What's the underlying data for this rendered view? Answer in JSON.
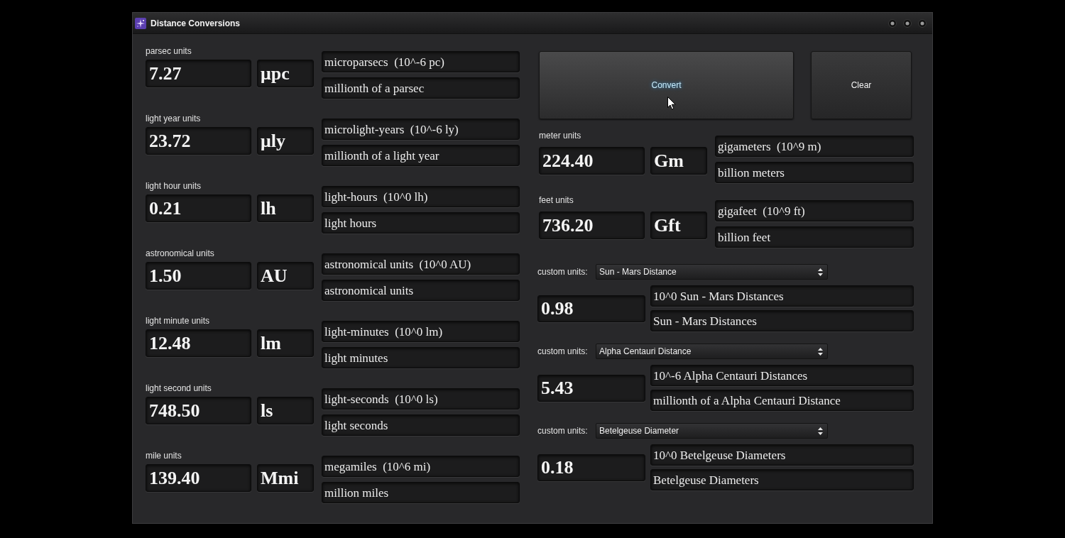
{
  "window": {
    "title": "Distance Conversions"
  },
  "unit_groups": [
    {
      "label": "parsec units",
      "value": "7.27",
      "unit": "μpc",
      "scale": "microparsecs  (10^-6 pc)",
      "description": "millionth of a parsec"
    },
    {
      "label": "light year units",
      "value": "23.72",
      "unit": "μly",
      "scale": "microlight-years  (10^-6 ly)",
      "description": "millionth of a light year"
    },
    {
      "label": "light hour units",
      "value": "0.21",
      "unit": "lh",
      "scale": "light-hours  (10^0 lh)",
      "description": "light hours"
    },
    {
      "label": "astronomical units",
      "value": "1.50",
      "unit": "AU",
      "scale": "astronomical units  (10^0 AU)",
      "description": "astronomical units"
    },
    {
      "label": "light minute units",
      "value": "12.48",
      "unit": "lm",
      "scale": "light-minutes  (10^0 lm)",
      "description": "light minutes"
    },
    {
      "label": "light second units",
      "value": "748.50",
      "unit": "ls",
      "scale": "light-seconds  (10^0 ls)",
      "description": "light seconds"
    },
    {
      "label": "mile units",
      "value": "139.40",
      "unit": "Mmi",
      "scale": "megamiles  (10^6 mi)",
      "description": "million miles"
    }
  ],
  "buttons": [
    {
      "label": "Convert",
      "hovered": true
    },
    {
      "label": "Clear",
      "hovered": false
    }
  ],
  "right_unit_groups": [
    {
      "label": "meter units",
      "value": "224.40",
      "unit": "Gm",
      "scale": "gigameters  (10^9 m)",
      "description": "billion meters"
    },
    {
      "label": "feet units",
      "value": "736.20",
      "unit": "Gft",
      "scale": "gigafeet  (10^9 ft)",
      "description": "billion feet"
    }
  ],
  "custom_groups": [
    {
      "label": "custom units:",
      "selection": "Sun - Mars Distance",
      "value": "0.98",
      "scale": "10^0 Sun - Mars Distances",
      "description": "Sun - Mars Distances"
    },
    {
      "label": "custom units:",
      "selection": "Alpha Centauri Distance",
      "value": "5.43",
      "scale": "10^-6 Alpha Centauri Distances",
      "description": "millionth of a Alpha Centauri Distance"
    },
    {
      "label": "custom units:",
      "selection": "Betelgeuse Diameter",
      "value": "0.18",
      "scale": "10^0 Betelgeuse Diameters",
      "description": "Betelgeuse Diameters"
    }
  ]
}
